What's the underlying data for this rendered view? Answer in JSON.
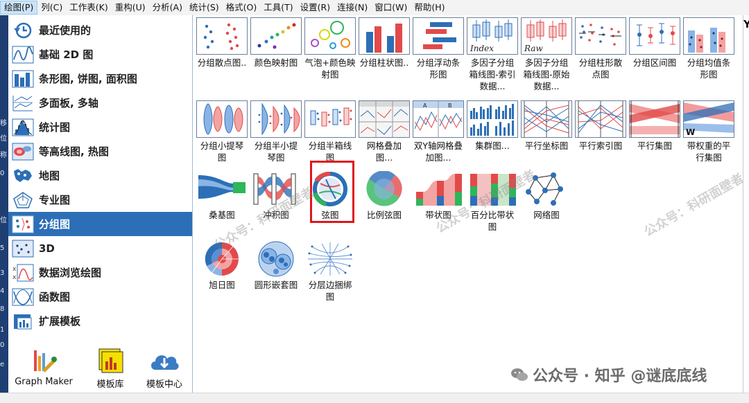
{
  "menubar": {
    "items": [
      "绘图(P)",
      "列(C)",
      "工作表(K)",
      "重构(U)",
      "分析(A)",
      "统计(S)",
      "格式(O)",
      "工具(T)",
      "设置(R)",
      "连接(N)",
      "窗口(W)",
      "帮助(H)"
    ],
    "active_index": 0,
    "tail": "Y"
  },
  "left_strip_ticks": [
    "移",
    "位",
    "称",
    "0",
    "位",
    "5",
    "3",
    "4",
    "8",
    "1",
    "0",
    "e"
  ],
  "categories": [
    {
      "label": "最近使用的",
      "icon": "clock-icon"
    },
    {
      "label": "基础 2D 图",
      "icon": "line-chart-icon"
    },
    {
      "label": "条形图, 饼图, 面积图",
      "icon": "bar-chart-icon"
    },
    {
      "label": "多面板, 多轴",
      "icon": "multi-panel-icon"
    },
    {
      "label": "统计图",
      "icon": "histogram-icon"
    },
    {
      "label": "等高线图, 热图",
      "icon": "heatmap-icon"
    },
    {
      "label": "地图",
      "icon": "map-icon"
    },
    {
      "label": "专业图",
      "icon": "pentagon-icon"
    },
    {
      "label": "分组图",
      "icon": "grouped-icon"
    },
    {
      "label": "3D",
      "icon": "scatter-3d-icon"
    },
    {
      "label": "数据浏览绘图",
      "icon": "data-browse-icon"
    },
    {
      "label": "函数图",
      "icon": "function-icon"
    },
    {
      "label": "扩展模板",
      "icon": "template-ext-icon"
    }
  ],
  "selected_category_index": 8,
  "bottom_buttons": [
    {
      "label": "Graph Maker",
      "icon": "graph-maker-icon"
    },
    {
      "label": "模板库",
      "icon": "template-library-icon"
    },
    {
      "label": "模板中心",
      "icon": "cloud-download-icon"
    }
  ],
  "gallery": [
    {
      "label": "分组散点图..",
      "thumb": "grouped-scatter"
    },
    {
      "label": "颜色映射图",
      "thumb": "color-map"
    },
    {
      "label": "气泡+颜色映射图",
      "thumb": "bubble-color"
    },
    {
      "label": "分组柱状图..",
      "thumb": "grouped-bar"
    },
    {
      "label": "分组浮动条形图",
      "thumb": "floating-bar"
    },
    {
      "label": "多因子分组箱线图-索引数据...",
      "thumb": "box-index"
    },
    {
      "label": "多因子分组箱线图-原始数据...",
      "thumb": "box-raw"
    },
    {
      "label": "分组柱形散点图",
      "thumb": "column-scatter"
    },
    {
      "label": "分组区间图",
      "thumb": "interval"
    },
    {
      "label": "分组均值条形图",
      "thumb": "mean-bar"
    },
    {
      "label": "分组小提琴图",
      "thumb": "violin"
    },
    {
      "label": "分组半小提琴图",
      "thumb": "half-violin"
    },
    {
      "label": "分组半箱线图",
      "thumb": "half-box"
    },
    {
      "label": "网格叠加图...",
      "thumb": "grid-overlay"
    },
    {
      "label": "双Y轴网格叠加图...",
      "thumb": "double-y-grid"
    },
    {
      "label": "集群图...",
      "thumb": "cluster"
    },
    {
      "label": "平行坐标图",
      "thumb": "parallel-coord"
    },
    {
      "label": "平行索引图",
      "thumb": "parallel-index"
    },
    {
      "label": "平行集图",
      "thumb": "parallel-sets"
    },
    {
      "label": "带权重的平行集图",
      "thumb": "weighted-parallel"
    },
    {
      "label": "桑基图",
      "thumb": "sankey"
    },
    {
      "label": "冲积图",
      "thumb": "alluvial"
    },
    {
      "label": "弦图",
      "thumb": "chord"
    },
    {
      "label": "比例弦图",
      "thumb": "prop-chord"
    },
    {
      "label": "带状图",
      "thumb": "ribbon"
    },
    {
      "label": "百分比带状图",
      "thumb": "pct-ribbon"
    },
    {
      "label": "网络图",
      "thumb": "network"
    },
    {
      "label": "旭日图",
      "thumb": "sunburst"
    },
    {
      "label": "圆形嵌套图",
      "thumb": "circle-packing"
    },
    {
      "label": "分层边捆绑图",
      "thumb": "edge-bundling"
    }
  ],
  "thumb_text": {
    "index": "Index",
    "raw": "Raw",
    "grid_a": "A",
    "grid_b": "B",
    "weight_w": "W"
  },
  "highlighted_tile_index": 22,
  "watermarks": [
    "公众号：科研面壁者",
    "公众号：科研面壁者",
    "公众号：科研面壁者"
  ],
  "credit": "公众号 · 知乎 @谜底底线",
  "colors": {
    "accent": "#2c6fb7",
    "highlight": "#e0161e",
    "menu_active": "#cce4f7"
  }
}
